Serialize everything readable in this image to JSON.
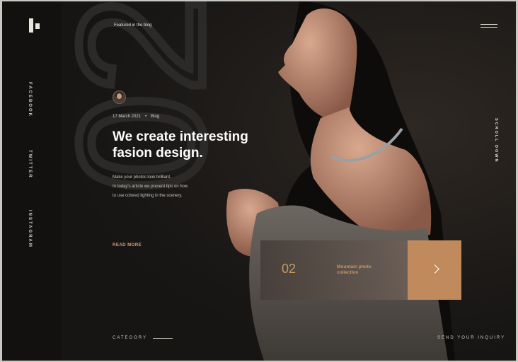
{
  "header": {
    "featured_label": "Featured in the blog"
  },
  "social": {
    "items": [
      "FACEBOOK",
      "TWITTER",
      "INSTAGRAM"
    ]
  },
  "hero": {
    "big_number": "02",
    "date": "17 March 2021",
    "category": "Blog",
    "headline_line1": "We create interesting",
    "headline_line2": "fasion design.",
    "paragraph_line1": "Make your photos look brilliant.",
    "paragraph_line2": "In today's article we present tips on how",
    "paragraph_line3": "to use colored lighting in the scenery.",
    "read_more": "READ MORE"
  },
  "card": {
    "number": "02",
    "title_line1": "Mountain photo",
    "title_line2": "collection"
  },
  "scroll_label": "SCROLL DOWN",
  "footer": {
    "category_label": "CATEGORY",
    "inquiry_label": "SEND YOUR INQUIRY"
  },
  "colors": {
    "accent": "#c08a5c",
    "background": "#161514"
  }
}
